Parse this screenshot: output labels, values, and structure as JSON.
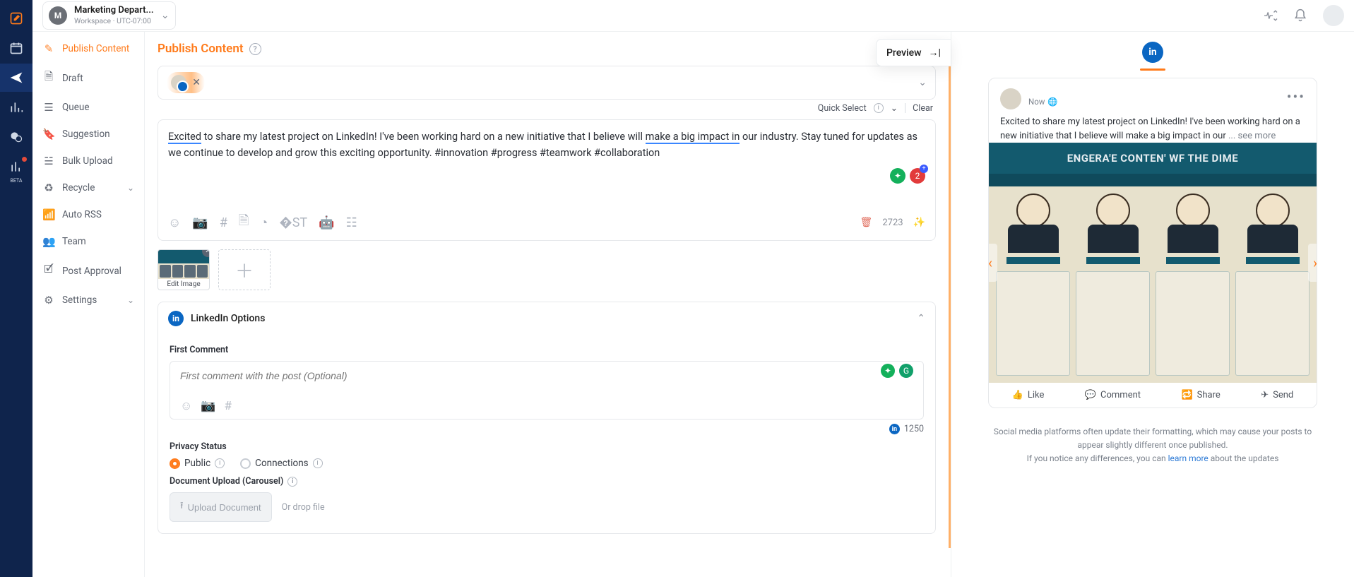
{
  "workspace": {
    "initial": "M",
    "name": "Marketing Depart...",
    "subtitle": "Workspace · UTC-07:00"
  },
  "sidebar": {
    "items": [
      {
        "label": "Publish Content"
      },
      {
        "label": "Draft"
      },
      {
        "label": "Queue"
      },
      {
        "label": "Suggestion"
      },
      {
        "label": "Bulk Upload"
      },
      {
        "label": "Recycle"
      },
      {
        "label": "Auto RSS"
      },
      {
        "label": "Team"
      },
      {
        "label": "Post Approval"
      },
      {
        "label": "Settings"
      }
    ]
  },
  "composer": {
    "heading": "Publish Content",
    "preview_label": "Preview",
    "quick_select": "Quick Select",
    "clear": "Clear",
    "text_pre": "Excited",
    "text_mid1": " to share my latest project on LinkedIn! I've been working hard on a new initiative that I believe will ",
    "text_ul2": "make a big impact in",
    "text_post": " our industry. Stay tuned for updates as we continue to develop and grow this exciting opportunity. #innovation #progress #teamwork #collaboration",
    "char_count": "2723",
    "edit_image": "Edit Image"
  },
  "linkedin": {
    "title": "LinkedIn Options",
    "first_comment_label": "First Comment",
    "first_comment_placeholder": "First comment with the post (Optional)",
    "fc_count": "1250",
    "privacy_label": "Privacy Status",
    "opt_public": "Public",
    "opt_connections": "Connections",
    "doc_label": "Document Upload (Carousel)",
    "upload_btn": "Upload Document",
    "or_drop": "Or drop file"
  },
  "preview": {
    "now": "Now",
    "body": "Excited to share my latest project on LinkedIn! I've been working hard on a new initiative that I believe will make a big impact in our ",
    "see_more": "... see more",
    "banner": "ENGERA'E CONTEN' WF THE DIME",
    "like": "Like",
    "comment": "Comment",
    "share": "Share",
    "send": "Send",
    "disclaimer1": "Social media platforms often update their formatting, which may cause your posts to appear slightly different once published.",
    "disclaimer2a": "If you notice any differences, you can ",
    "disclaimer2b": "learn more",
    "disclaimer2c": " about the updates"
  }
}
